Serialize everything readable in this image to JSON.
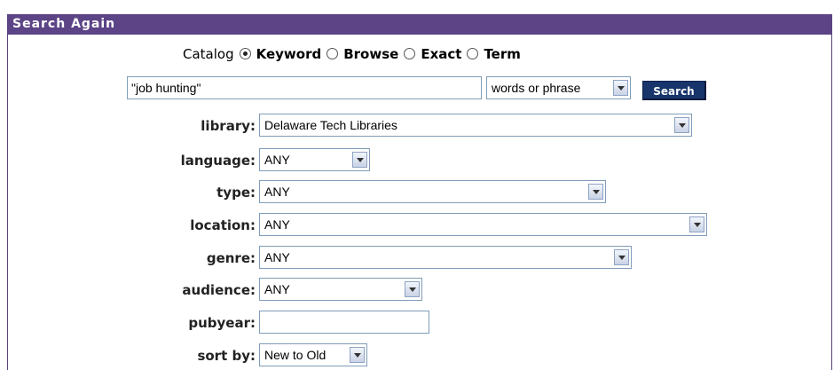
{
  "header": {
    "title": "Search Again"
  },
  "modes": {
    "prefix": "Catalog",
    "options": [
      "Keyword",
      "Browse",
      "Exact",
      "Term"
    ],
    "selected": "Keyword"
  },
  "query": {
    "value": "\"job hunting\"",
    "match_type": "words or phrase",
    "search_button": "Search"
  },
  "fields": {
    "library": {
      "label": "library:",
      "value": "Delaware Tech Libraries"
    },
    "language": {
      "label": "language:",
      "value": "ANY"
    },
    "type": {
      "label": "type:",
      "value": "ANY"
    },
    "location": {
      "label": "location:",
      "value": "ANY"
    },
    "genre": {
      "label": "genre:",
      "value": "ANY"
    },
    "audience": {
      "label": "audience:",
      "value": "ANY"
    },
    "pubyear": {
      "label": "pubyear:",
      "value": ""
    },
    "sortby": {
      "label": "sort by:",
      "value": "New to Old"
    }
  },
  "colors": {
    "header_bg": "#5c4486",
    "button_bg": "#17346b"
  }
}
